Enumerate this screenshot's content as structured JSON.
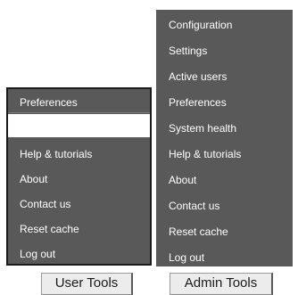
{
  "user_tools": {
    "caption": "User Tools",
    "items": [
      {
        "label": "Preferences"
      },
      {
        "label": "Help & tutorials"
      },
      {
        "label": "About"
      },
      {
        "label": "Contact us"
      },
      {
        "label": "Reset cache"
      },
      {
        "label": "Log out"
      }
    ],
    "input_value": ""
  },
  "admin_tools": {
    "caption": "Admin Tools",
    "items": [
      {
        "label": "Configuration"
      },
      {
        "label": "Settings"
      },
      {
        "label": "Active users"
      },
      {
        "label": "Preferences"
      },
      {
        "label": "System health"
      },
      {
        "label": "Help & tutorials"
      },
      {
        "label": "About"
      },
      {
        "label": "Contact us"
      },
      {
        "label": "Reset cache"
      },
      {
        "label": "Log out"
      }
    ]
  },
  "colors": {
    "menu_background": "#595959",
    "menu_text": "#ffffff",
    "caption_background": "#ececec"
  }
}
